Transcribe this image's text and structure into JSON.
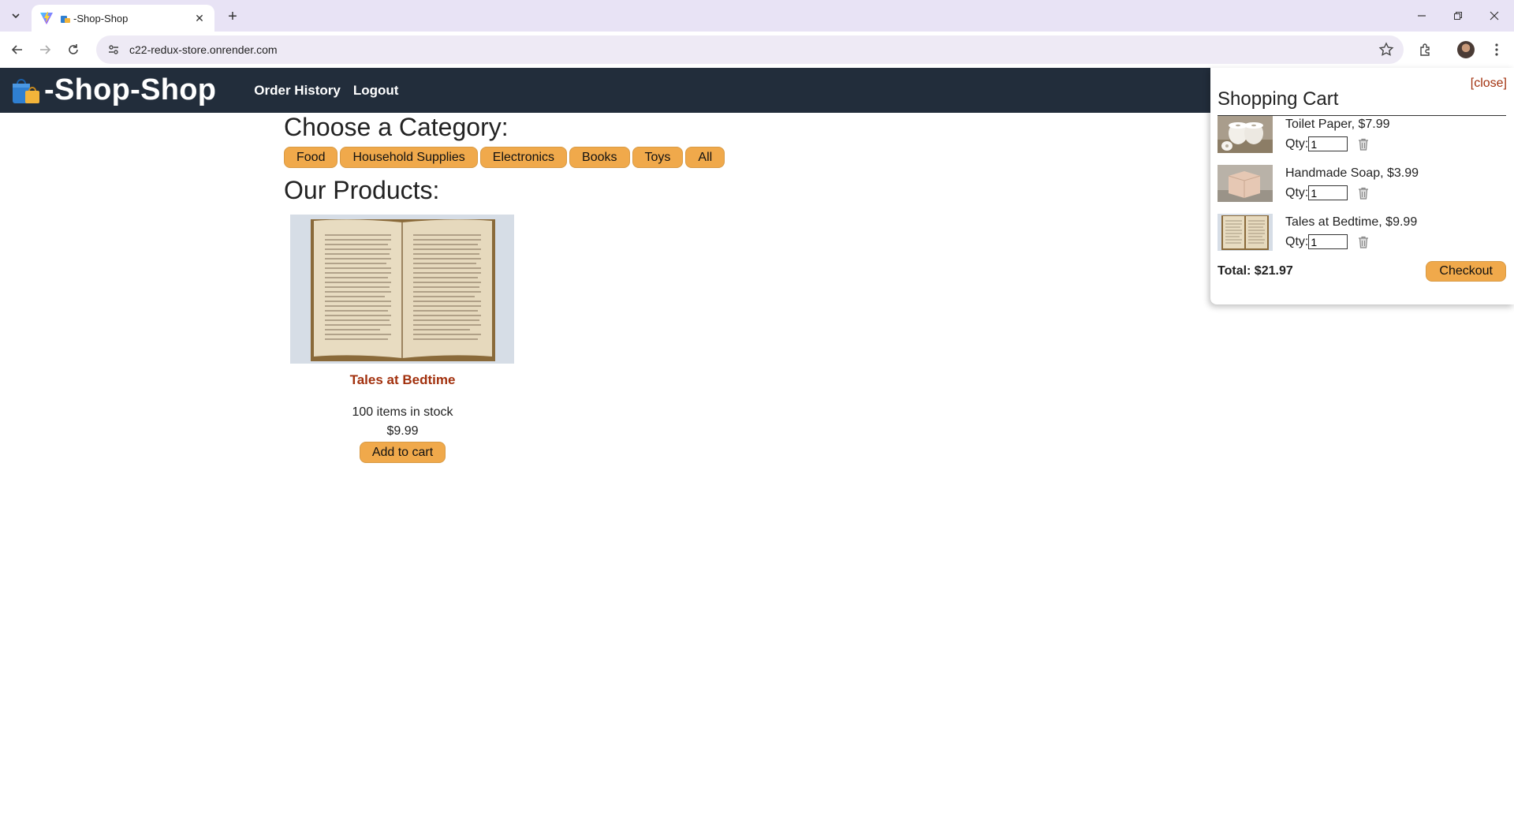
{
  "browser": {
    "tab_title": "-Shop-Shop",
    "tab_icon": "shopping-bag-emoji",
    "url": "c22-redux-store.onrender.com"
  },
  "header": {
    "brand_name": "-Shop-Shop",
    "brand_icon": "shopping-bags-emoji",
    "nav": {
      "order_history": "Order History",
      "logout": "Logout"
    },
    "background_color": "#222d3b"
  },
  "categories": {
    "heading": "Choose a Category:",
    "items": [
      "Food",
      "Household Supplies",
      "Electronics",
      "Books",
      "Toys",
      "All"
    ],
    "button_color": "#f0a94b"
  },
  "products": {
    "heading": "Our Products:",
    "items": [
      {
        "name": "Tales at Bedtime",
        "image": "open-book-photo",
        "stock_text": "100 items in stock",
        "price": "$9.99",
        "add_label": "Add to cart"
      }
    ]
  },
  "cart": {
    "close_label": "[close]",
    "title": "Shopping Cart",
    "qty_label": "Qty:",
    "items": [
      {
        "label": "Toilet Paper, $7.99",
        "qty": "1",
        "image": "toilet-paper-photo"
      },
      {
        "label": "Handmade Soap, $3.99",
        "qty": "1",
        "image": "soap-photo"
      },
      {
        "label": "Tales at Bedtime, $9.99",
        "qty": "1",
        "image": "book-photo"
      }
    ],
    "total": "Total: $21.97",
    "checkout_label": "Checkout",
    "accent_color": "#a2310e"
  }
}
